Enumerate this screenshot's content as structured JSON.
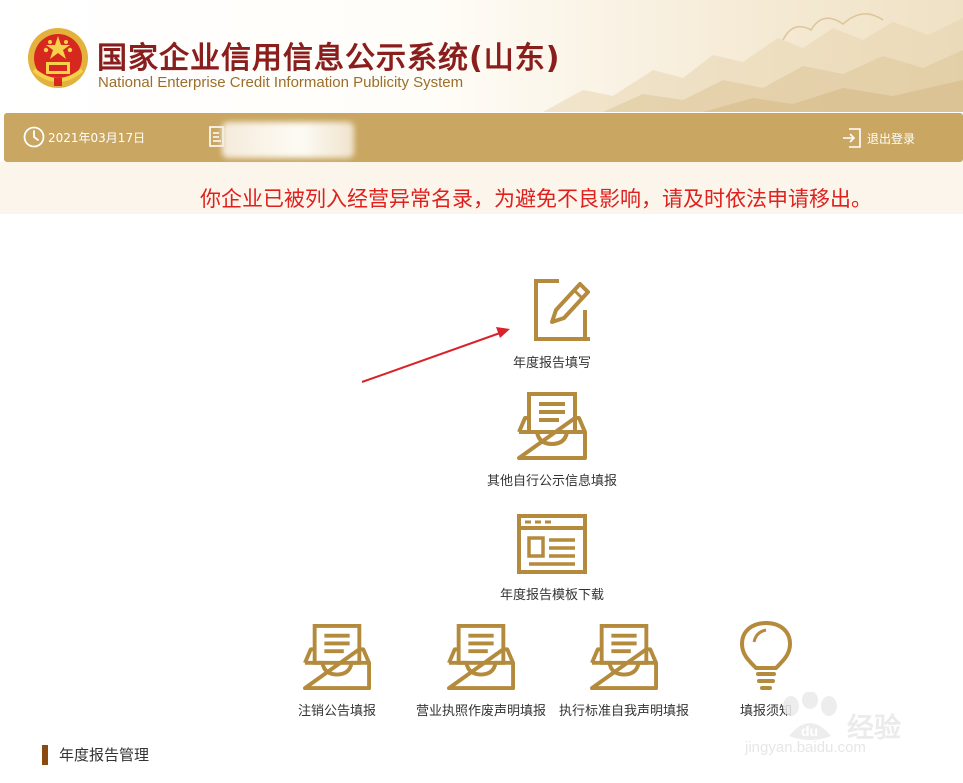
{
  "header": {
    "title_cn": "国家企业信用信息公示系统(山东)",
    "title_en": "National Enterprise Credit Information Publicity System"
  },
  "toolbar": {
    "date": "2021年03月17日",
    "logout_label": "退出登录"
  },
  "notice": {
    "text": "你企业已被列入经营异常名录，为避免不良影响，请及时依法申请移出。"
  },
  "tiles": [
    {
      "label": "年度报告填写",
      "icon": "edit-pencil-icon"
    },
    {
      "label": "其他自行公示信息填报",
      "icon": "inbox-tray-icon"
    },
    {
      "label": "年度报告模板下载",
      "icon": "template-window-icon"
    },
    {
      "label": "注销公告填报",
      "icon": "inbox-tray-icon"
    },
    {
      "label": "营业执照作废声明填报",
      "icon": "inbox-tray-icon"
    },
    {
      "label": "执行标准自我声明填报",
      "icon": "inbox-tray-icon"
    },
    {
      "label": "填报须知",
      "icon": "lightbulb-icon"
    }
  ],
  "section": {
    "title": "年度报告管理"
  },
  "watermark": {
    "cn": "经验",
    "en": "jingyan.baidu.com"
  },
  "colors": {
    "gold_bar": "#c9a661",
    "icon_gold": "#b48a3c",
    "notice_red": "#e0201d",
    "title_red": "#8a1e1c",
    "arrow_red": "#d9232a"
  }
}
